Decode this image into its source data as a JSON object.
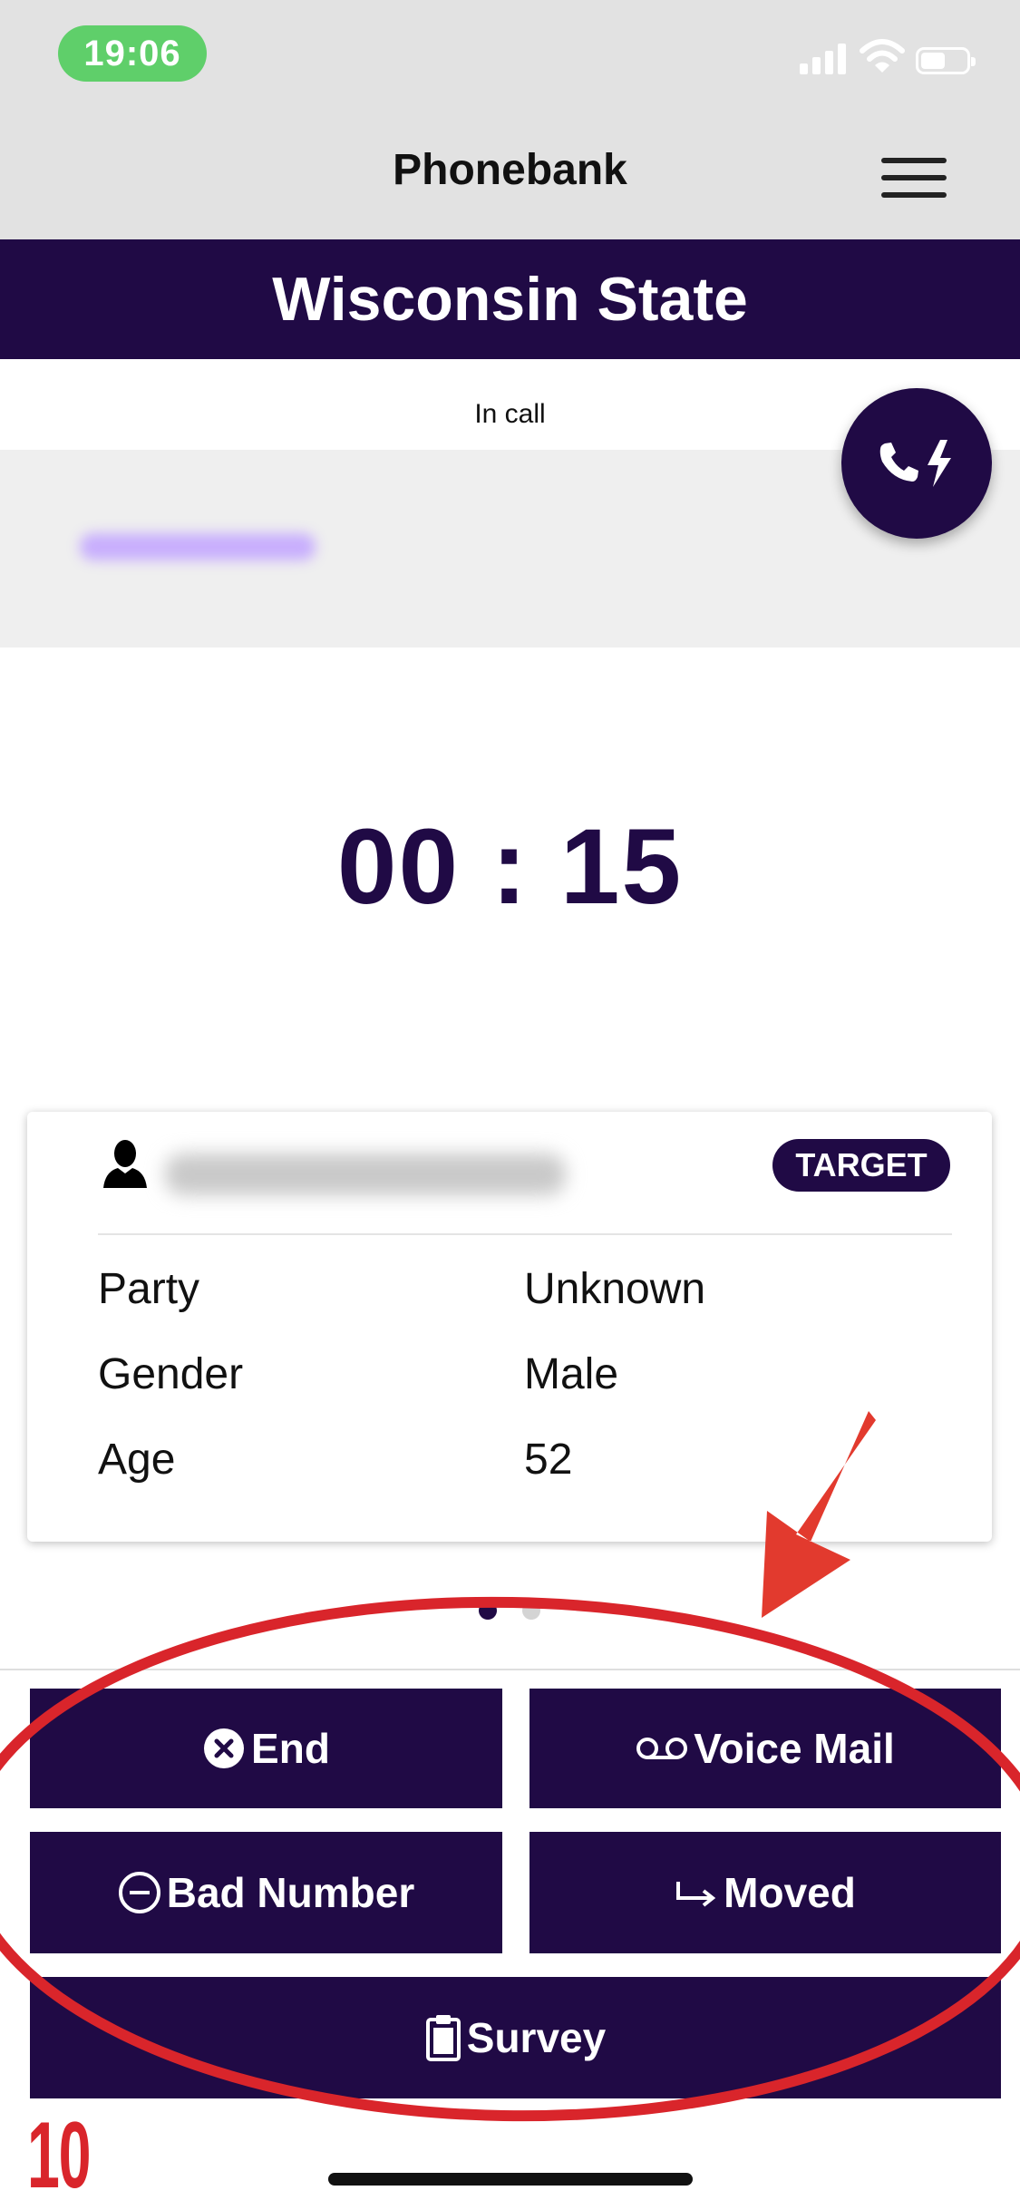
{
  "status_bar": {
    "time": "19:06"
  },
  "header": {
    "title": "Phonebank"
  },
  "campaign": {
    "name": "Wisconsin State"
  },
  "call": {
    "status": "In call",
    "timer": "00 : 15"
  },
  "contact": {
    "badge": "TARGET",
    "fields": [
      {
        "label": "Party",
        "value": "Unknown"
      },
      {
        "label": "Gender",
        "value": "Male"
      },
      {
        "label": "Age",
        "value": "52"
      }
    ]
  },
  "pager": {
    "current_page": 1,
    "total_pages": 2
  },
  "actions": {
    "end": "End",
    "voicemail": "Voice Mail",
    "bad_number": "Bad Number",
    "moved": "Moved",
    "survey": "Survey"
  },
  "annotation": {
    "number": "10",
    "color": "#d9252b"
  },
  "colors": {
    "brand": "#200a45",
    "header_bg": "#e2e2e2",
    "status_pill": "#5fcf6a"
  },
  "icons": {
    "fab": "phone-bolt-icon",
    "person": "person-icon",
    "end": "close-circle-icon",
    "voicemail": "voicemail-icon",
    "bad_number": "minus-circle-icon",
    "moved": "forward-arrow-icon",
    "survey": "clipboard-icon",
    "menu": "hamburger-menu-icon"
  }
}
